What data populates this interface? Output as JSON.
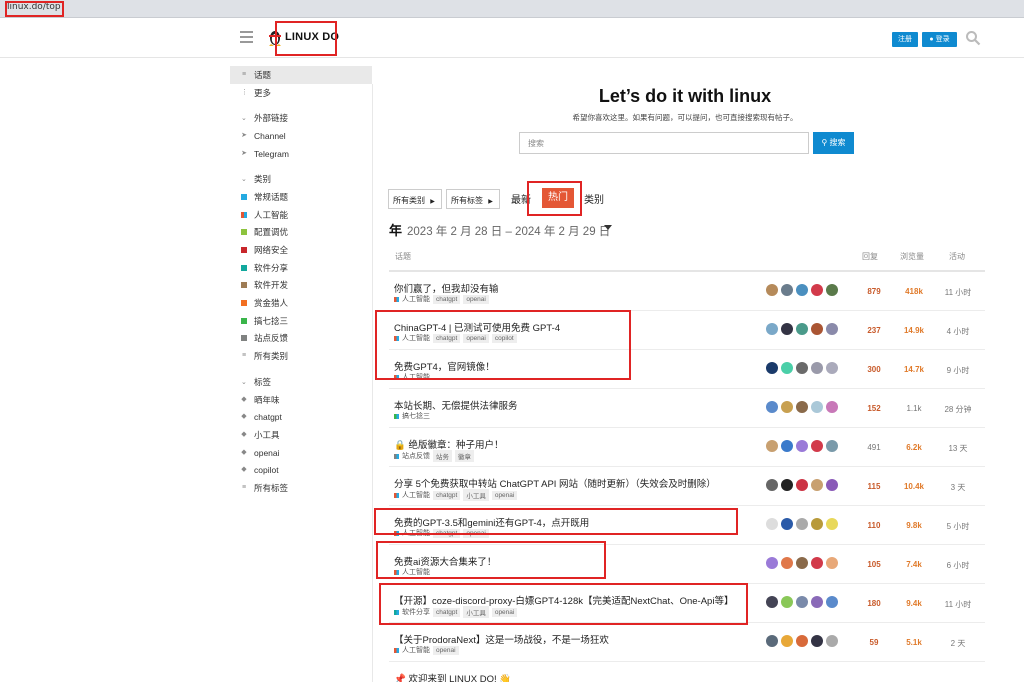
{
  "browser": {
    "url": "linux.do/top"
  },
  "header": {
    "logo_text": "LINUX DO",
    "register_label": "注册",
    "login_label": "登录"
  },
  "sidebar": {
    "top_items": [
      {
        "label": "话题",
        "icon": "layers-icon",
        "active": true
      },
      {
        "label": "更多",
        "icon": "vertical-dots-icon",
        "active": false
      }
    ],
    "external_heading": "外部链接",
    "external_items": [
      {
        "label": "Channel",
        "icon": "telegram-icon"
      },
      {
        "label": "Telegram",
        "icon": "telegram-icon"
      }
    ],
    "categories_heading": "类别",
    "categories": [
      {
        "label": "常规话题",
        "color": "#25aae1"
      },
      {
        "label": "人工智能",
        "color": "#e45735"
      },
      {
        "label": "配置调优",
        "color": "#8dc33e"
      },
      {
        "label": "网络安全",
        "color": "#c8262b"
      },
      {
        "label": "软件分享",
        "color": "#12a89d"
      },
      {
        "label": "软件开发",
        "color": "#9e7c55"
      },
      {
        "label": "赏金猎人",
        "color": "#f26f21"
      },
      {
        "label": "搞七捻三",
        "color": "#3ab54a"
      },
      {
        "label": "站点反馈",
        "color": "#808281"
      },
      {
        "label": "所有类别",
        "color": ""
      }
    ],
    "tags_heading": "标签",
    "tags": [
      {
        "label": "晒年味",
        "icon": "tag-icon"
      },
      {
        "label": "chatgpt",
        "icon": "tag-icon"
      },
      {
        "label": "小工具",
        "icon": "tag-icon"
      },
      {
        "label": "openai",
        "icon": "tag-icon"
      },
      {
        "label": "copilot",
        "icon": "tag-icon"
      },
      {
        "label": "所有标签",
        "icon": "list-icon"
      }
    ]
  },
  "hero": {
    "title": "Let’s do it with linux",
    "subtitle": "希望你喜欢这里。如果有问题，可以提问，也可直接搜索现有帖子。",
    "search_placeholder": "搜索",
    "search_button": "搜索"
  },
  "nav": {
    "categories_dropdown": "所有类别",
    "tags_dropdown": "所有标签",
    "latest": "最新",
    "hot": "热门",
    "categories": "类别"
  },
  "period": {
    "label": "年",
    "range": "2023 年 2 月 28 日 – 2024 年 2 月 29 日"
  },
  "table": {
    "headers": {
      "topic": "话题",
      "replies": "回复",
      "views": "浏览量",
      "activity": "活动"
    },
    "rows": [
      {
        "title": "你们赢了，但我却没有输",
        "category": "人工智能",
        "cat_color": "#e45735",
        "tags": [
          "chatgpt",
          "openai"
        ],
        "replies": "879",
        "views": "418k",
        "activity": "11 小时",
        "hot": true,
        "avatars": [
          "#b58a5a",
          "#6a7c8c",
          "#4a8fbf",
          "#d23a4a",
          "#5a7a4a"
        ]
      },
      {
        "title": "ChinaGPT-4 | 已测试可使用免费 GPT-4",
        "category": "人工智能",
        "cat_color": "#e45735",
        "tags": [
          "chatgpt",
          "openai",
          "copilot"
        ],
        "replies": "237",
        "views": "14.9k",
        "activity": "4 小时",
        "hot": true,
        "avatars": [
          "#7aa8c8",
          "#333344",
          "#4a9a8a",
          "#aa5533",
          "#8a8aaa"
        ]
      },
      {
        "title": "免费GPT4，官网镜像！",
        "category": "人工智能",
        "cat_color": "#e45735",
        "tags": [],
        "replies": "300",
        "views": "14.7k",
        "activity": "9 小时",
        "hot": true,
        "avatars": [
          "#1a3a6a",
          "#4acfa8",
          "#6a6a6a",
          "#9a9aaa",
          "#aaaabb"
        ]
      },
      {
        "title": "本站长期、无偿提供法律服务",
        "category": "搞七捻三",
        "cat_color": "#3ab54a",
        "tags": [],
        "replies": "152",
        "views": "1.1k",
        "activity": "28 分钟",
        "hot": false,
        "avatars": [
          "#5a8acb",
          "#c8a050",
          "#8a6a4a",
          "#aac8d8",
          "#c878b8"
        ]
      },
      {
        "title": "🔒 绝版徽章：种子用户！",
        "category": "站点反馈",
        "cat_color": "#808281",
        "tags": [
          "站务",
          "徽章"
        ],
        "replies": "491",
        "views": "6.2k",
        "activity": "13 天",
        "hot": false,
        "avatars": [
          "#c8a070",
          "#3a7acb",
          "#9a7ad8",
          "#d23a4a",
          "#7a9aaa"
        ]
      },
      {
        "title": "分享 5个免费获取中转站 ChatGPT API 网站（随时更新）（失效会及时删除）",
        "category": "人工智能",
        "cat_color": "#e45735",
        "tags": [
          "chatgpt",
          "小工具",
          "openai"
        ],
        "replies": "115",
        "views": "10.4k",
        "activity": "3 天",
        "hot": false,
        "avatars": [
          "#666666",
          "#222222",
          "#cc3344",
          "#c8a070",
          "#8a5ab8"
        ]
      },
      {
        "title": "免费的GPT-3.5和gemini还有GPT-4，点开既用",
        "category": "人工智能",
        "cat_color": "#e45735",
        "tags": [
          "chatgpt",
          "openai"
        ],
        "replies": "110",
        "views": "9.8k",
        "activity": "5 小时",
        "hot": false,
        "avatars": [
          "#dddddd",
          "#2a5aa8",
          "#aaaaaa",
          "#b89a3a",
          "#e8d85a"
        ]
      },
      {
        "title": "免费ai资源大合集来了！",
        "category": "人工智能",
        "cat_color": "#e45735",
        "tags": [],
        "replies": "105",
        "views": "7.4k",
        "activity": "6 小时",
        "hot": false,
        "avatars": [
          "#9a7ad8",
          "#e0784a",
          "#8a6a4a",
          "#d23a4a",
          "#e8a878"
        ]
      },
      {
        "title": "【开源】coze-discord-proxy-白嫖GPT4-128k【完美适配NextChat、One-Api等】",
        "category": "软件分享",
        "cat_color": "#12a89d",
        "tags": [
          "chatgpt",
          "小工具",
          "openai"
        ],
        "replies": "180",
        "views": "9.4k",
        "activity": "11 小时",
        "hot": false,
        "avatars": [
          "#444455",
          "#8ac858",
          "#7a8aaa",
          "#8a6ab8",
          "#5a8acb"
        ]
      },
      {
        "title": "【关于ProdoraNext】这是一场战役，不是一场狂欢",
        "category": "人工智能",
        "cat_color": "#e45735",
        "tags": [
          "openai"
        ],
        "replies": "59",
        "views": "5.1k",
        "activity": "2 天",
        "hot": false,
        "avatars": [
          "#5a6a7a",
          "#e8a838",
          "#d86a3a",
          "#333344",
          "#aaaaaa"
        ]
      },
      {
        "title": "📌 欢迎来到 LINUX DO! 👋",
        "category": "",
        "cat_color": "",
        "tags": [],
        "replies": "",
        "views": "",
        "activity": "",
        "hot": false,
        "avatars": []
      }
    ]
  }
}
